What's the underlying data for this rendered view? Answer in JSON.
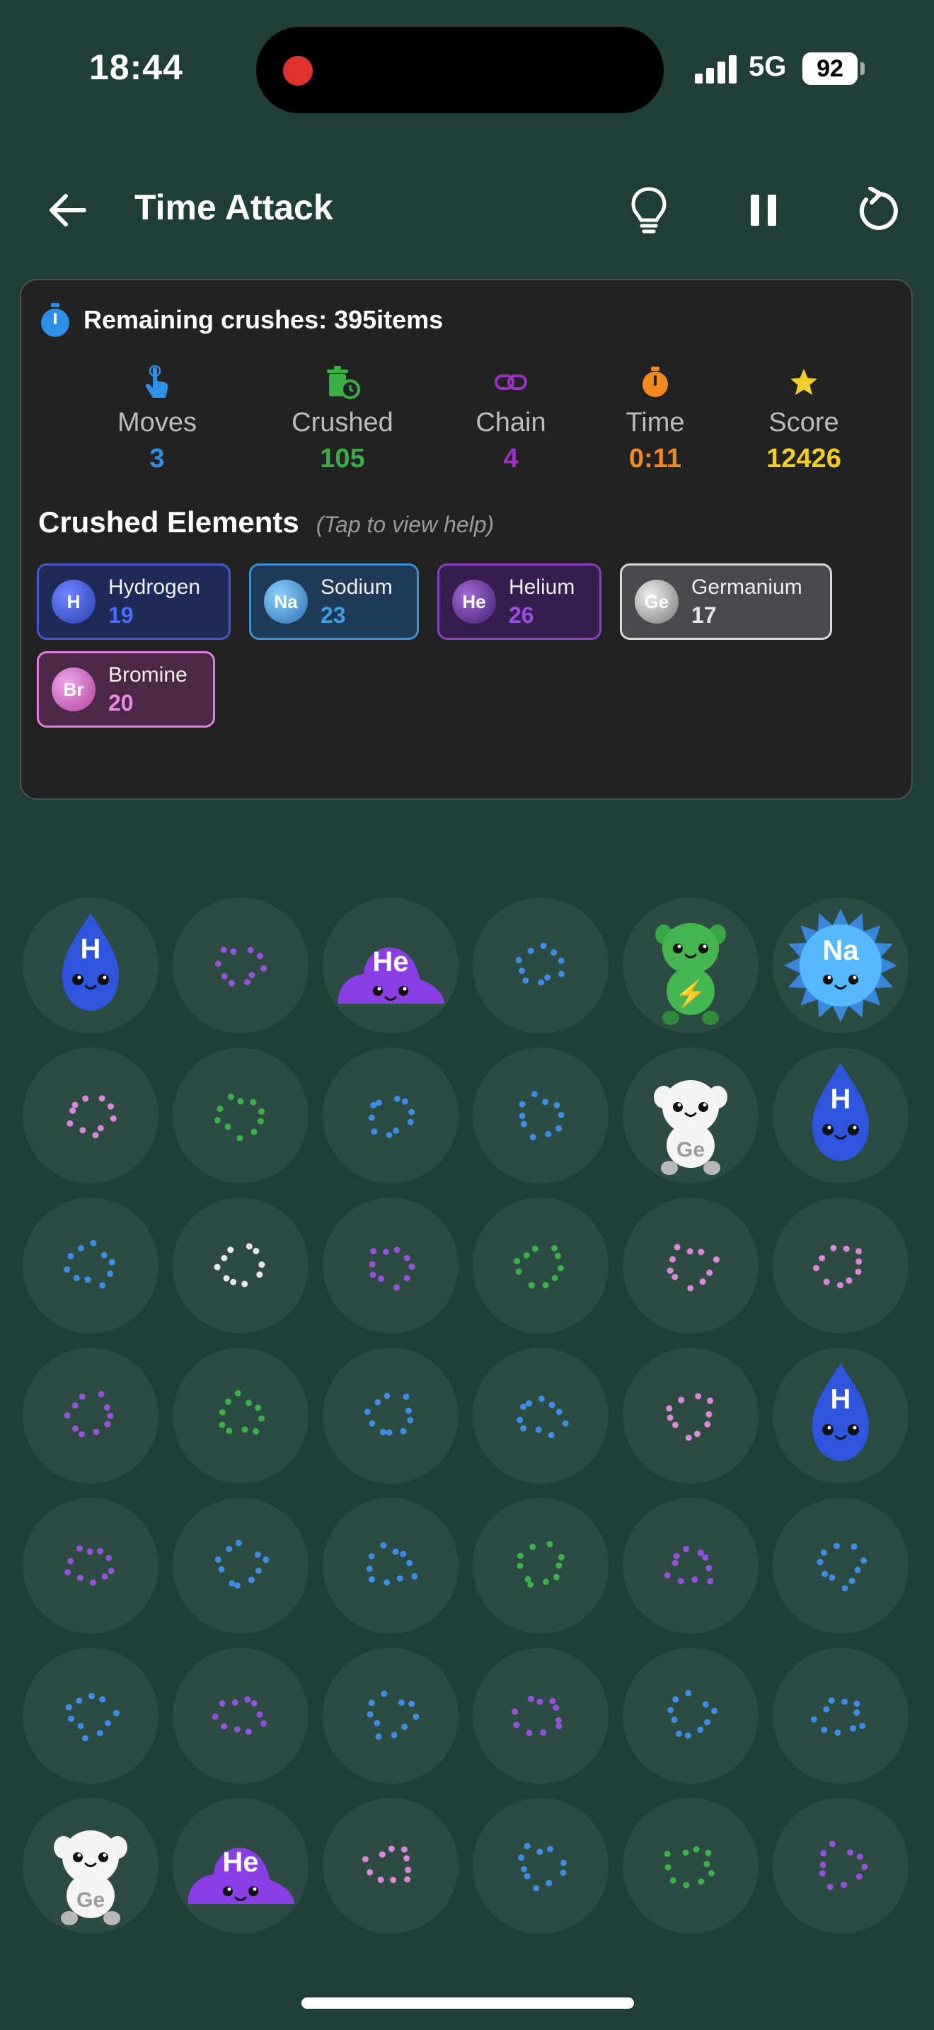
{
  "status_bar": {
    "time": "18:44",
    "network": "5G",
    "battery": "92"
  },
  "header": {
    "title": "Time Attack"
  },
  "colors": {
    "background": "#1f3e36",
    "panel": "#232223",
    "moves": "#2e8fe6",
    "crushed": "#3cae46",
    "chain": "#9b32c4",
    "time": "#f08a1c",
    "score": "#f5cd2a"
  },
  "panel": {
    "remaining": "Remaining crushes: 395items",
    "stats": [
      {
        "label": "Moves",
        "value": "3",
        "icon": "pointer-hand-icon"
      },
      {
        "label": "Crushed",
        "value": "105",
        "icon": "trash-clock-icon"
      },
      {
        "label": "Chain",
        "value": "4",
        "icon": "link-icon"
      },
      {
        "label": "Time",
        "value": "0:11",
        "icon": "stopwatch-icon"
      },
      {
        "label": "Score",
        "value": "12426",
        "icon": "star-icon"
      }
    ],
    "crushed_title": "Crushed Elements",
    "crushed_help": "(Tap to view help)",
    "elements": [
      {
        "symbol": "H",
        "name": "Hydrogen",
        "count": "19"
      },
      {
        "symbol": "Na",
        "name": "Sodium",
        "count": "23"
      },
      {
        "symbol": "He",
        "name": "Helium",
        "count": "26"
      },
      {
        "symbol": "Ge",
        "name": "Germanium",
        "count": "17"
      },
      {
        "symbol": "Br",
        "name": "Bromine",
        "count": "20"
      }
    ]
  },
  "board": {
    "rows": [
      [
        "H",
        "purple",
        "He",
        "blue",
        "thunder",
        "Na"
      ],
      [
        "pink",
        "green",
        "blue",
        "blue",
        "Ge",
        "H"
      ],
      [
        "blue",
        "white",
        "purple",
        "green",
        "pink",
        "pink"
      ],
      [
        "purple",
        "green",
        "blue",
        "blue",
        "pink",
        "H"
      ],
      [
        "purple",
        "blue",
        "blue",
        "green",
        "purple",
        "blue"
      ],
      [
        "blue",
        "purple",
        "blue",
        "purple",
        "blue",
        "blue"
      ],
      [
        "Ge",
        "He",
        "pink",
        "blue",
        "green",
        "purple"
      ]
    ],
    "labels": {
      "H": "H",
      "He": "He",
      "Na": "Na",
      "Ge": "Ge",
      "thunder": "⚡"
    }
  }
}
